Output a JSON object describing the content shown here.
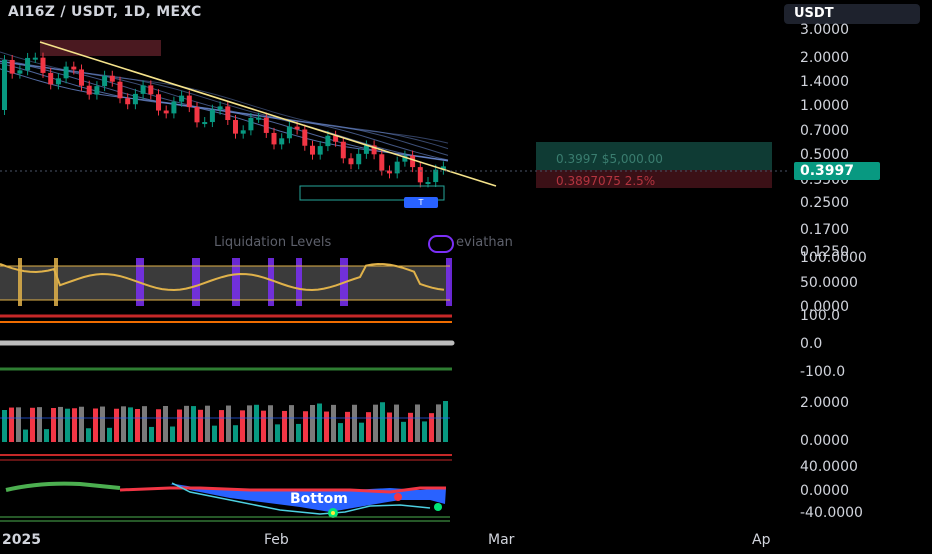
{
  "header": {
    "title": "AI16Z / USDT, 1D, MEXC",
    "currency_button": "USDT"
  },
  "price_axis": [
    "3.0000",
    "2.0000",
    "1.4000",
    "1.0000",
    "0.7000",
    "0.5000",
    "0.3500",
    "0.2500",
    "0.1700",
    "0.1250"
  ],
  "current_price": "0.3997",
  "position": {
    "entry_label": "0.3997  $5,000.00",
    "stop_label": "0.3897075  2.5%"
  },
  "watermark": "Liquidation Levels",
  "watermark_suffix": "eviathan",
  "marker_label": "T",
  "oscillator_axis": [
    "100.0000",
    "50.0000",
    "0.0000"
  ],
  "cci_axis": [
    "100.0",
    "0.0",
    "-100.0"
  ],
  "volume_axis": [
    "2.0000",
    "0.0000"
  ],
  "momentum_axis": [
    "40.0000",
    "0.0000",
    "-40.0000"
  ],
  "momentum_label": "Bottom",
  "time_axis": [
    "2025",
    "Feb",
    "Mar",
    "Ap"
  ],
  "colors": {
    "bull": "#089981",
    "bear": "#f23645",
    "trendline": "#f5e38b",
    "ribbon": "#6f8fd8",
    "oscillator": "#e0b24a",
    "highlight": "#7b2ff7"
  }
}
